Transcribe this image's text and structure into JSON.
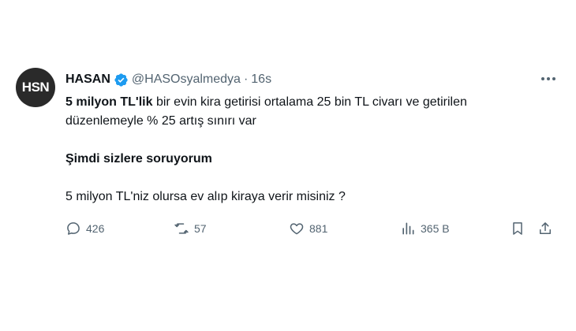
{
  "user": {
    "name": "HASAN",
    "handle": "@HASOsyalmedya",
    "separator": "·",
    "time": "16s",
    "avatar_text": "HSN"
  },
  "tweet": {
    "line1_bold": "5 milyon TL'lik",
    "line1_rest": " bir evin kira getirisi ortalama 25 bin TL civarı ve getirilen",
    "line2": "düzenlemeyle % 25 artış sınırı var",
    "line3_bold": "Şimdi sizlere soruyorum",
    "line4": "5 milyon TL'niz olursa ev alıp kiraya verir misiniz ?"
  },
  "actions": {
    "replies": "426",
    "retweets": "57",
    "likes": "881",
    "views": "365 B"
  },
  "colors": {
    "verified": "#1d9bf0",
    "muted": "#536471",
    "text": "#0f1419"
  }
}
